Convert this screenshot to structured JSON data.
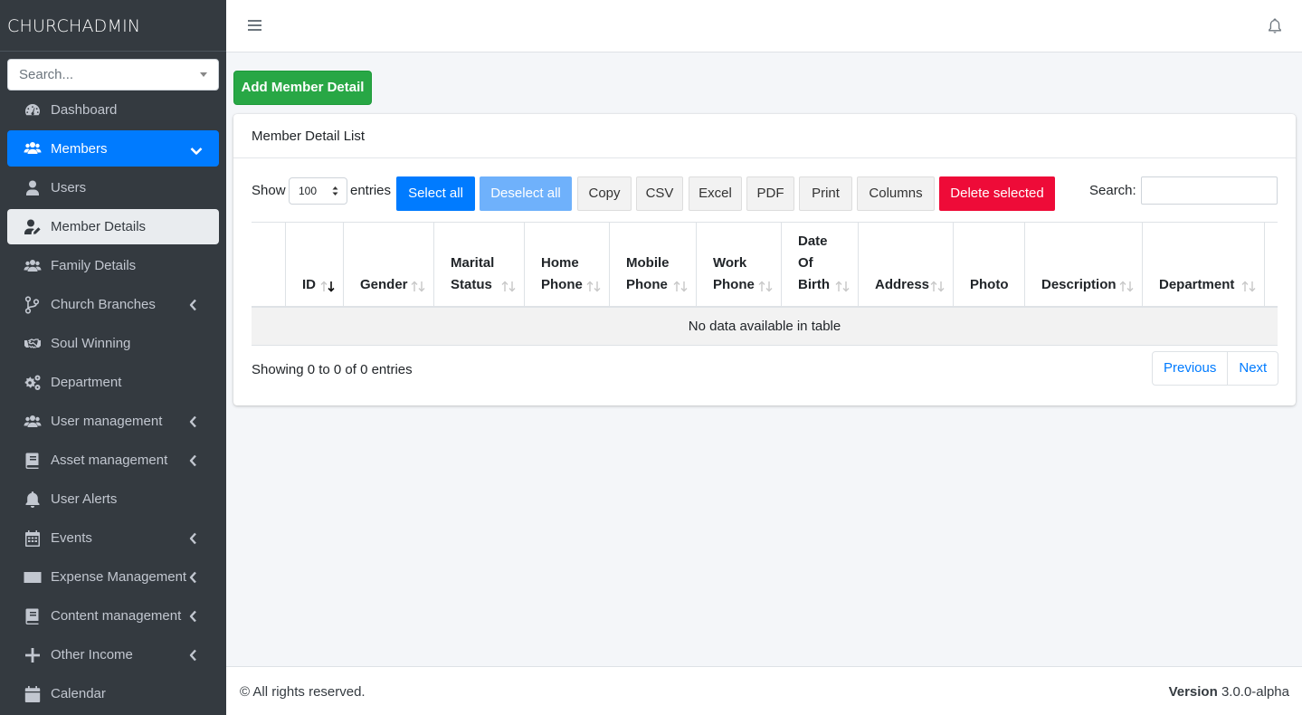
{
  "app": {
    "brand": "CHURCHADMIN"
  },
  "sidebar": {
    "search_placeholder": "Search...",
    "items": [
      {
        "label": "Dashboard",
        "icon": "tachometer-icon"
      },
      {
        "label": "Members",
        "icon": "users-icon",
        "state": "active",
        "arrow": "chevron-down-icon"
      },
      {
        "label": "Users",
        "icon": "user-icon"
      },
      {
        "label": "Member Details",
        "icon": "user-edit-icon",
        "state": "selected"
      },
      {
        "label": "Family Details",
        "icon": "users-icon"
      },
      {
        "label": "Church Branches",
        "icon": "code-branch-icon",
        "arrow": "chevron-left-icon"
      },
      {
        "label": "Soul Winning",
        "icon": "handshake-icon"
      },
      {
        "label": "Department",
        "icon": "cogs-icon"
      },
      {
        "label": "User management",
        "icon": "users-icon",
        "arrow": "chevron-left-icon"
      },
      {
        "label": "Asset management",
        "icon": "book-icon",
        "arrow": "chevron-left-icon"
      },
      {
        "label": "User Alerts",
        "icon": "bell-icon"
      },
      {
        "label": "Events",
        "icon": "calendar-grid-icon",
        "arrow": "chevron-left-icon"
      },
      {
        "label": "Expense Management",
        "icon": "money-bill-icon",
        "arrow": "chevron-left-icon"
      },
      {
        "label": "Content management",
        "icon": "book-icon",
        "arrow": "chevron-left-icon"
      },
      {
        "label": "Other Income",
        "icon": "plus-icon",
        "arrow": "chevron-left-icon"
      },
      {
        "label": "Calendar",
        "icon": "calendar-icon"
      }
    ]
  },
  "main": {
    "add_button": "Add Member Detail",
    "card_title": "Member Detail List",
    "show_label": "Show",
    "page_length": "100",
    "entries_label": "entries",
    "buttons": {
      "select_all": "Select all",
      "deselect_all": "Deselect all",
      "copy": "Copy",
      "csv": "CSV",
      "excel": "Excel",
      "pdf": "PDF",
      "print": "Print",
      "columns": "Columns",
      "delete_selected": "Delete selected"
    },
    "search_label": "Search:",
    "search_value": "",
    "columns": [
      {
        "label": "",
        "sort": "none"
      },
      {
        "label": "ID",
        "sort": "desc"
      },
      {
        "label": "Gender",
        "sort": "both"
      },
      {
        "label": "Marital Status",
        "sort": "both"
      },
      {
        "label": "Home Phone",
        "sort": "both"
      },
      {
        "label": "Mobile Phone",
        "sort": "both"
      },
      {
        "label": "Work Phone",
        "sort": "both"
      },
      {
        "label": "Date Of Birth",
        "sort": "both"
      },
      {
        "label": "Address",
        "sort": "both"
      },
      {
        "label": "Photo",
        "sort": "none"
      },
      {
        "label": "Description",
        "sort": "both"
      },
      {
        "label": "Department",
        "sort": "both"
      }
    ],
    "empty_message": "No data available in table",
    "info": "Showing 0 to 0 of 0 entries",
    "pagination": {
      "previous": "Previous",
      "next": "Next"
    }
  },
  "footer": {
    "copyright": "© All rights reserved.",
    "version_label": "Version",
    "version_value": "3.0.0-alpha"
  },
  "colors": {
    "sidebar_bg": "#343a40",
    "primary": "#007bff",
    "success": "#28a745",
    "danger": "#ee0b38"
  }
}
